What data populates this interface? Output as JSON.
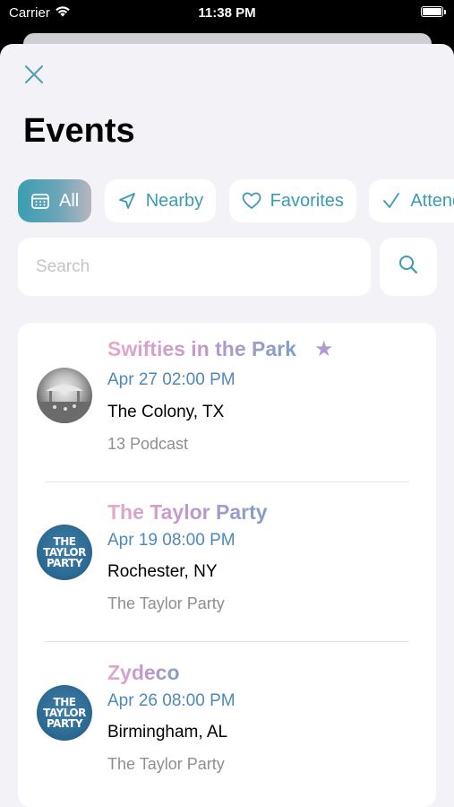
{
  "status_bar": {
    "carrier": "Carrier",
    "time": "11:38 PM",
    "icons": [
      "wifi-icon",
      "battery-icon"
    ]
  },
  "sheet": {
    "title": "Events",
    "close_icon": "close-icon"
  },
  "filters": [
    {
      "label": "All",
      "icon": "calendar-icon",
      "active": true
    },
    {
      "label": "Nearby",
      "icon": "location-arrow-icon",
      "active": false
    },
    {
      "label": "Favorites",
      "icon": "heart-icon",
      "active": false
    },
    {
      "label": "Attending",
      "icon": "checkmark-icon",
      "active": false
    }
  ],
  "search": {
    "placeholder": "Search",
    "value": "",
    "icon": "search-icon"
  },
  "events": [
    {
      "name": "Swifties in the Park",
      "favorite": true,
      "date": "Apr 27 02:00 PM",
      "location": "The Colony, TX",
      "organizer": "13 Podcast",
      "avatar": "photo"
    },
    {
      "name": "The Taylor Party",
      "favorite": false,
      "date": "Apr 19 08:00 PM",
      "location": "Rochester, NY",
      "organizer": "The Taylor Party",
      "avatar": "logo"
    },
    {
      "name": "Zydeco",
      "favorite": false,
      "date": "Apr 26 08:00 PM",
      "location": "Birmingham, AL",
      "organizer": "The Taylor Party",
      "avatar": "logo"
    }
  ],
  "logo_text": [
    "THE",
    "TAYLOR",
    "PARTY"
  ],
  "colors": {
    "accent": "#3b9bb0",
    "date": "#4e89b7",
    "secondary_text": "#8e8e93",
    "background": "#f2f2f7"
  }
}
